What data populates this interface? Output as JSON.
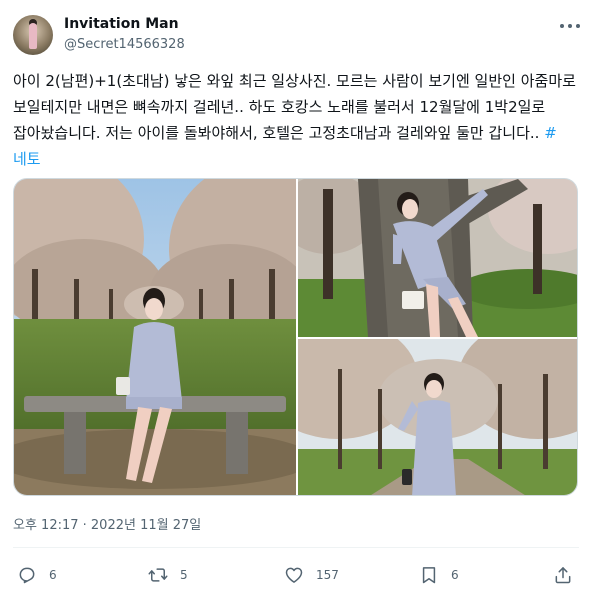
{
  "user": {
    "display_name": "Invitation Man",
    "handle": "@Secret14566328",
    "avatar_icon": "avatar-photo"
  },
  "tweet": {
    "text": "아이 2(남편)+1(초대남) 낳은 와잎 최근 일상사진. 모르는 사람이 보기엔 일반인 아줌마로 보일테지만 내면은 뼈속까지 걸레년.. 하도 호캉스 노래를 불러서 12월달에 1박2일로 잡아놨습니다. 저는 아이를 돌봐야해서, 호텔은 고정초대남과 걸레와잎 둘만 갑니다.. ",
    "hashtag": "#네토",
    "photos": [
      {
        "alt": "woman sitting on park bench under cherry trees"
      },
      {
        "alt": "woman leaning on tree trunk"
      },
      {
        "alt": "woman standing in cherry blossom park"
      }
    ]
  },
  "meta": {
    "timestamp": "오후 12:17 · 2022년 11월 27일"
  },
  "actions": {
    "reply_count": "6",
    "retweet_count": "5",
    "like_count": "157",
    "bookmark_count": "6"
  },
  "colors": {
    "text": "#0f1419",
    "secondary": "#536471",
    "link": "#1d9bf0",
    "divider": "#eff3f4"
  }
}
